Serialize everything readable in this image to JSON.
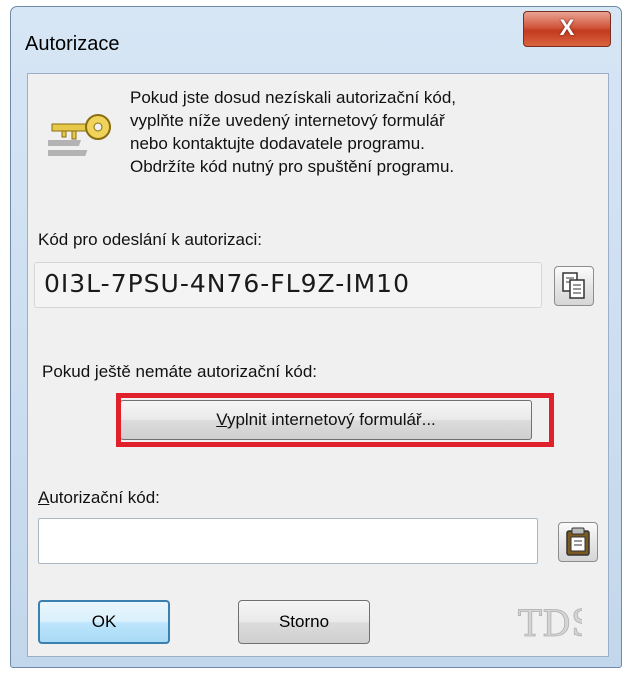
{
  "window": {
    "title": "Autorizace",
    "close_symbol": "X"
  },
  "intro": {
    "icon": "key-icon",
    "lines": [
      "Pokud jste dosud nezískali autorizační kód,",
      "vyplňte níže uvedený internetový formulář",
      "nebo kontaktujte dodavatele programu.",
      "Obdržíte kód nutný pro spuštění programu."
    ]
  },
  "send_code": {
    "label": "Kód pro odeslání k autorizaci:",
    "value": "0I3L-7PSU-4N76-FL9Z-IM10",
    "copy_icon": "copy-icon"
  },
  "no_code": {
    "label": "Pokud ještě nemáte autorizační kód:",
    "button_accel": "V",
    "button_rest": "yplnit internetový formulář..."
  },
  "auth_code": {
    "label_accel": "A",
    "label_rest": "utorizační kód:",
    "value": "",
    "paste_icon": "paste-icon"
  },
  "buttons": {
    "ok": "OK",
    "cancel": "Storno"
  },
  "logo": "TDS",
  "colors": {
    "highlight": "#e0202a",
    "close": "#c33a20",
    "ok_border": "#3c7fb1"
  }
}
